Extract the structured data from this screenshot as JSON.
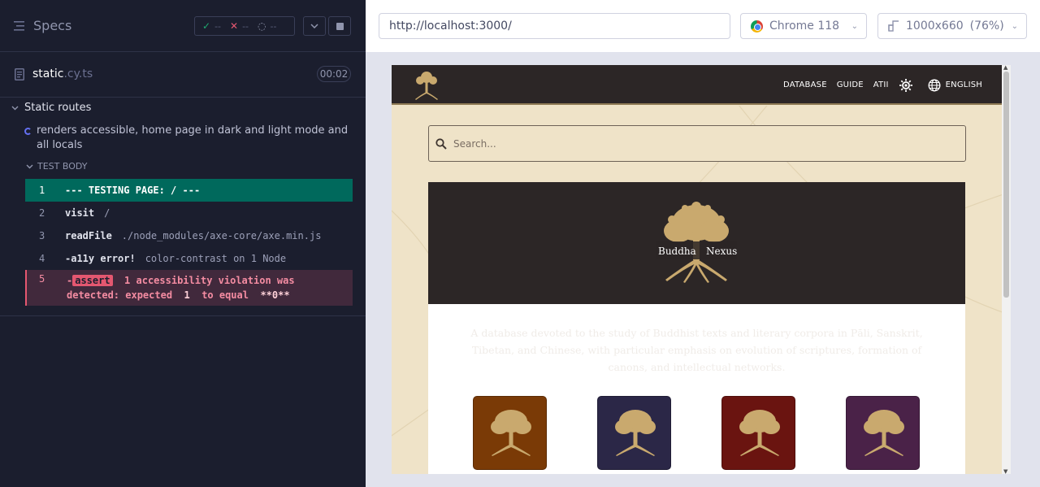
{
  "reporter": {
    "specs_label": "Specs",
    "stats": {
      "passed": "--",
      "failed": "--",
      "pending": "--"
    },
    "spec": {
      "name": "static",
      "ext": ".cy.ts",
      "duration": "00:02"
    },
    "suite_title": "Static routes",
    "test_title": "renders accessible, home page in dark and light mode and all locals",
    "test_body_label": "TEST BODY",
    "commands": [
      {
        "num": "1",
        "method": "--- TESTING PAGE: / ---",
        "message": ""
      },
      {
        "num": "2",
        "method": "visit",
        "message": "/"
      },
      {
        "num": "3",
        "method": "readFile",
        "message": "./node_modules/axe-core/axe.min.js"
      },
      {
        "num": "4",
        "method": "-a11y error!",
        "message": "color-contrast on 1 Node"
      },
      {
        "num": "5",
        "prefix": "-",
        "tag": "assert",
        "message_a": "1 accessibility violation was detected: expected",
        "value": "1",
        "message_b": "to equal",
        "expected": "**0**"
      }
    ]
  },
  "aut": {
    "url": "http://localhost:3000/",
    "browser": "Chrome 118",
    "viewport": "1000x660",
    "zoom": "(76%)"
  },
  "site": {
    "nav": [
      "DATABASE",
      "GUIDE",
      "ATII"
    ],
    "language": "ENGLISH",
    "search_placeholder": "Search...",
    "logo_text_left": "Buddha",
    "logo_text_right": "Nexus",
    "description": "A database devoted to the study of Buddhist texts and literary corpora in Pāli, Sanskrit, Tibetan, and Chinese, with particular emphasis on evolution of scriptures, formation of canons, and intellectual networks.",
    "tile_colors": [
      "#7a3a06",
      "#2b2747",
      "#6a1410",
      "#4a2248"
    ],
    "accent_gold": "#c9a96e"
  }
}
